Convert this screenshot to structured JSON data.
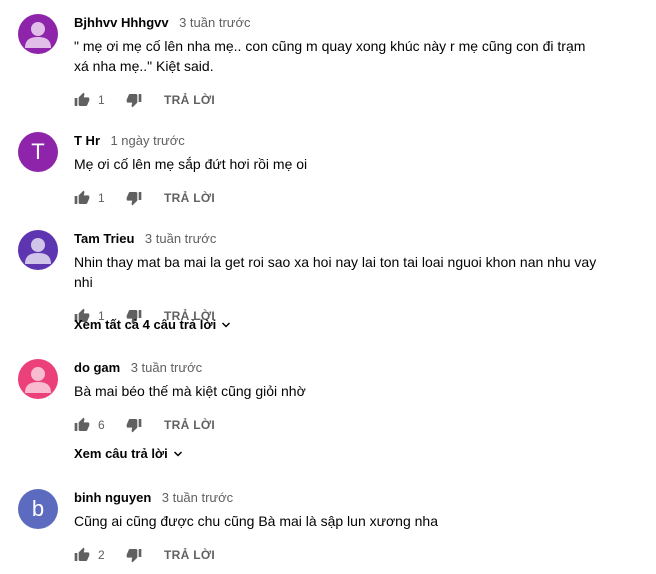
{
  "reply_label": "TRẢ LỜI",
  "comments": [
    {
      "author": "Bjhhvv Hhhgvv",
      "time": "3 tuần trước",
      "text": "\" mẹ ơi mẹ cố lên nha mẹ.. con cũng m quay xong khúc này r mẹ cũng con đi trạm xá nha mẹ..\" Kiệt said.",
      "likes": "1",
      "avatar_color": "#8e24aa",
      "avatar_type": "person"
    },
    {
      "author": "T Hr",
      "time": "1 ngày trước",
      "text": "Mẹ ơi cố lên mẹ sắp đứt hơi rồi mẹ oi",
      "likes": "1",
      "avatar_color": "#8e24aa",
      "avatar_type": "letter",
      "avatar_letter": "T"
    },
    {
      "author": "Tam Trieu",
      "time": "3 tuần trước",
      "text": "Nhin thay mat ba mai la get roi sao xa hoi nay lai ton tai loai nguoi khon nan nhu vay nhi",
      "likes": "1",
      "avatar_color": "#5e35b1",
      "avatar_type": "person",
      "view_replies": "Xem tất cả 4 câu trả lời"
    },
    {
      "author": "do gam",
      "time": "3 tuần trước",
      "text": "Bà mai béo thế mà kiệt cũng giỏi nhờ",
      "likes": "6",
      "avatar_color": "#ec407a",
      "avatar_type": "person",
      "view_replies": "Xem câu trả lời"
    },
    {
      "author": "binh nguyen",
      "time": "3 tuần trước",
      "text": "Cũng ai cũng được chu cũng Bà mai là sập lun xương nha",
      "likes": "2",
      "avatar_color": "#5c6bc0",
      "avatar_type": "letter",
      "avatar_letter": "b"
    }
  ]
}
